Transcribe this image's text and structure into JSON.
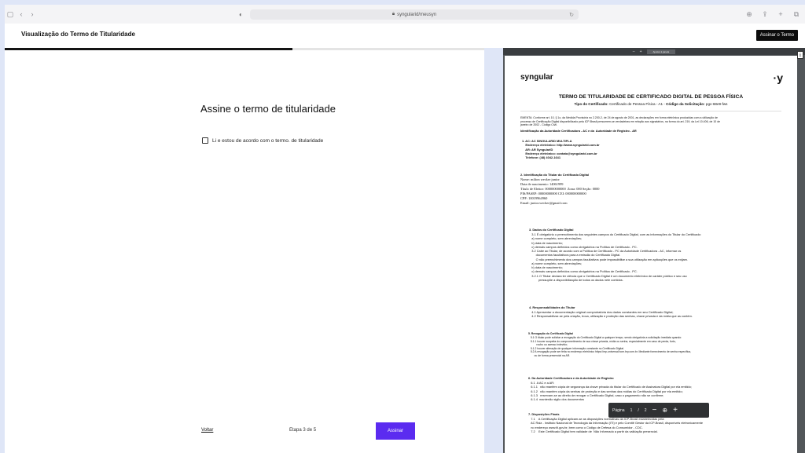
{
  "browser": {
    "url": "syngularid/meusyn"
  },
  "app": {
    "title": "Visualização do Termo de Titularidade",
    "sign_top_label": "Assinar o Termo"
  },
  "wizard": {
    "progress": 0.6,
    "heading": "Assine o termo de titularidade",
    "agree_label": "Li e estou de acordo com o termo. de titularidade",
    "back_label": "Voltar",
    "step_label": "Etapa 3 de 5",
    "sign_label": "Assinar"
  },
  "viewer": {
    "toolbar_minus": "–",
    "toolbar_plus": "+",
    "toolbar_fit": "Ajustar à janela",
    "pager": {
      "label": "Página",
      "current": "1",
      "separator": "/",
      "total": "2",
      "zoom_out": "−",
      "zoom_icon": "⊕",
      "zoom_in": "+"
    }
  },
  "document": {
    "logo": "syngular",
    "logo_right": "·y",
    "title": "TERMO DE TITULARIDADE DE CERTIFICADO DIGITAL DE PESSOA FÍSICA",
    "subtitle_label": "Tipo do Certificado:",
    "subtitle_value": " Certificado de Pessoa Física - A1 - ",
    "code_label": "Código da Solicitação:",
    "code_value": " pgv-68e9-fws",
    "ementa": "EMENTA: Conforme art. 10, § 1o, da Medida Provisória no 2.200-2, de 24 de agosto de 2001, as declarações em forma eletrônica produzidas com a utilização de\nprocesso de Certificação Digital disponibilizado pela ICP-Brasil presumem-se verdadeiras em relação aos signatários, na forma do art. 219, da Lei 10.406, de 10 de\njaneiro de 2002 - Código Civil.",
    "ementa_bold": "Identificação da Autoridade Certificadora - AC e da  Autoridade de Registro - AR",
    "ac_block": "1. AC: AC SINGULARID MULTIPLA\n    Endereço eletrônico: http://www.syngularid.com.br\n    AR: AR SyngularID\n    Endereço eletrônico: contato@syngularid.com.br\n    Telefone: (48) 4042-1641",
    "titular_head": "2. Identificação do Titular do Certificado Digital",
    "titular_block": "Nome: milton wecker junior\nData de nascimento: 14061999\nTítulo de Eleitor: 000000000000  Zona: 000 Seção: 0000\nPIS/PASEP: 00000000000 CEI: 000000000000\nCPF: 10019964960\nEmail: junior.wecker@gmail.com",
    "dados_head": "3. Dados do Certificado Digital",
    "dados_block": "   3.1 É obrigatório o preenchimento dos seguintes campos do Certificado Digital, com as informações do Titular do Certificado:\n   a) nome completo, sem abreviações;\n   b) data de nascimento;\n   c) demais campos definidos como obrigatórios na Política de Certificado - PC.\n   3.2 Cabe ao Titular, de acordo com a Política de Certificado - PC da Autoridade Certificadora - AC, informar os\n        documentos facultativos para a emissão do Certificado Digital.\n        O não preenchimento dos campos facultativos pode impossibilitar a sua utilização em aplicações que os exijam.\n   a) nome completo, sem abreviações;\n   b) data de nascimento;\n   c) demais campos definidos como obrigatórios na Política de Certificado - PC.\n   3.2.1 O Titular declara ter ciência que o Certificado Digital é um documento eletrônico de caráter público e seu uso\n           pressupõe a disponibilização de todos os dados nele contidos.",
    "resp_head": "4. Responsabilidades do Titular",
    "resp_block": "   4.1 Apresentar a documentação original comprobatória dos dados constantes em seu Certificado Digital;\n   4.2 Responsabilizar-se pela criação, troca, utilização e proteção das senhas, chave privada e da mídia que as contém.",
    "rev_head": "5. Revogação do Certificado Digital",
    "rev_block": "   5.1 O titular pode solicitar a revogação do Certificado Digital a qualquer tempo, sendo obrigatória a solicitação imediata quando:\n   5.1.1 houver suspeita do comprometimento de sua chave privada, mídia ou senha, especialmente em caso de perda, furto,\n           roubo ou acesso indevido;\n   5.1.2 houver alteração de qualquer informação constante no Certificado Digital.\n   5.2 A revogação pode ser feita no endereço eletrônico https://mp-universal.hom.bry.com.br. Mediante fornecimento de senha específica,\n        ou de forma presencial na AR.",
    "aut_head": "6. Da Autoridade Certificadora e da Autoridade de Registro",
    "aut_block": "   6.1  A AC e a AR:\n   6.1.1   não mantém cópia de segurança da chave privada do titular do Certificado de Assinatura Digital por ela emitido;\n   6.1.2   não mantém cópia da senhas de proteção e das senhas das mídias do Certificado Digital por ela emitido;\n   6.1.3   reservam-se ao direito de revogar o Certificado Digital, caso o pagamento não se confirme;\n   6.1.4  mantenão sigilo dos documentos",
    "disp_head": "7. Disposições Finais",
    "disp_block": "   7.1    A Certificação Digital aplicam-se as disposições normativas da ICP-Brasil estabelecidas pela\n   AC Raiz - Instituto Nacional de Tecnologia da Informação (ITI) e pelo Comitê Gestor da ICP-Brasil, disponíveis eletronicamente\n   no endereço www.iti.gov.br, bem como o Código de Defesa do Consumidor - CDC.\n   7.2    Este Certificado Digital tem validade de  Não Informado a partir da validação presencial."
  }
}
